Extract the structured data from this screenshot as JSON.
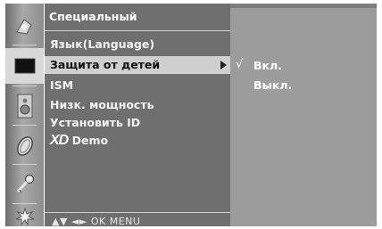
{
  "menu": {
    "title": "Специальный",
    "items": [
      {
        "label": "Язык(Language)"
      },
      {
        "label": "Защита от детей"
      },
      {
        "label": "ISM"
      },
      {
        "label": "Низк. мощность"
      },
      {
        "label": "Установить ID"
      },
      {
        "label": "Demo",
        "logo": "XD"
      }
    ],
    "selected_index": 1,
    "hint": "▲▼ ◄► OK MENU"
  },
  "submenu": {
    "check_mark": "√",
    "options": [
      {
        "label": "Вкл.",
        "checked": true
      },
      {
        "label": "Выкл.",
        "checked": false
      }
    ]
  },
  "icons": [
    {
      "name": "picture-icon"
    },
    {
      "name": "screen-icon",
      "selected": true
    },
    {
      "name": "speaker-icon"
    },
    {
      "name": "clock-icon"
    },
    {
      "name": "key-icon"
    },
    {
      "name": "settings-icon"
    }
  ],
  "colors": {
    "menu_bg": "#6f6f6f",
    "submenu_bg": "#9c9c9c",
    "highlight": "#cfcfcf",
    "text": "#ffffff"
  }
}
